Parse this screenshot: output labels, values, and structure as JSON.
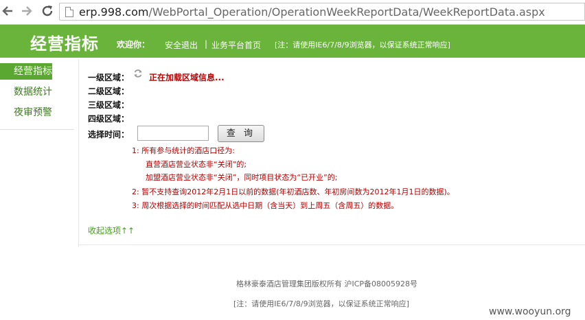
{
  "browser": {
    "url_host": "erp.998.com",
    "url_path": "/WebPortal_Operation/OperationWeekReportData/WeekReportData.aspx",
    "back_icon": "arrow-left-icon",
    "forward_icon": "arrow-right-icon",
    "reload_icon": "reload-icon"
  },
  "header": {
    "title": "经营指标",
    "welcome": "欢迎你：",
    "logout": "安全退出",
    "separator": "|",
    "home": "业务平台首页",
    "note": "[注：请使用IE6/7/8/9浏览器，以保证系统正常响应]",
    "bg_color": "#6ab43c"
  },
  "sidebar": {
    "items": [
      {
        "label": "经营指标"
      },
      {
        "label": "数据统计"
      },
      {
        "label": "夜审预警"
      }
    ]
  },
  "form": {
    "level1_label": "一级区域：",
    "level2_label": "二级区域：",
    "level3_label": "三级区域：",
    "level4_label": "四级区域：",
    "loading_text": "正在加载区域信息...",
    "date_label": "选择时间：",
    "date_value": "",
    "query_button": "查 询"
  },
  "notes": {
    "n1": "1: 所有参与统计的酒店口径为:",
    "n1a": "直营酒店营业状态非“关闭”的;",
    "n1b": "加盟酒店营业状态非“关闭”，同时项目状态为“已开业”的;",
    "n2": "2: 暂不支持查询2012年2月1日以前的数据(年初酒店数、年初房间数为2012年1月1日的数据)。",
    "n3": "3: 周次根据选择的时间匹配从选中日期（含当天）到上周五（含周五）的数据。"
  },
  "collapse_text": "收起选项↑↑",
  "footer": {
    "copyright": "格林豪泰酒店管理集团版权所有 沪ICP备08005928号",
    "note": "[注：请使用IE6/7/8/9浏览器，以保证系统正常响应]"
  },
  "watermark": "www.wooyun.org"
}
